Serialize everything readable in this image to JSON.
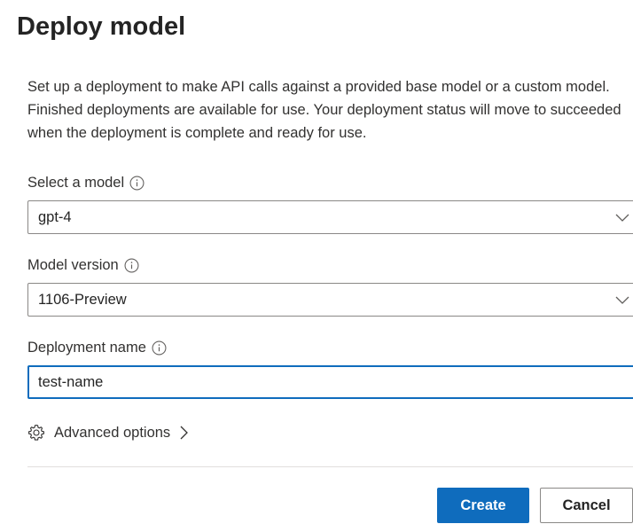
{
  "dialog": {
    "title": "Deploy model",
    "description": "Set up a deployment to make API calls against a provided base model or a custom model. Finished deployments are available for use. Your deployment status will move to succeeded when the deployment is complete and ready for use."
  },
  "fields": {
    "model": {
      "label": "Select a model",
      "value": "gpt-4"
    },
    "version": {
      "label": "Model version",
      "value": "1106-Preview"
    },
    "deployment_name": {
      "label": "Deployment name",
      "value": "test-name"
    }
  },
  "advanced": {
    "label": "Advanced options"
  },
  "actions": {
    "create_label": "Create",
    "cancel_label": "Cancel"
  },
  "colors": {
    "accent": "#0f6cbd",
    "border": "#8a8886",
    "divider": "#e1dfdd",
    "text": "#323130"
  },
  "icons": {
    "info": "info-icon",
    "dropdown": "chevron-down-icon",
    "advanced": "gear-icon",
    "expand": "chevron-right-icon"
  }
}
